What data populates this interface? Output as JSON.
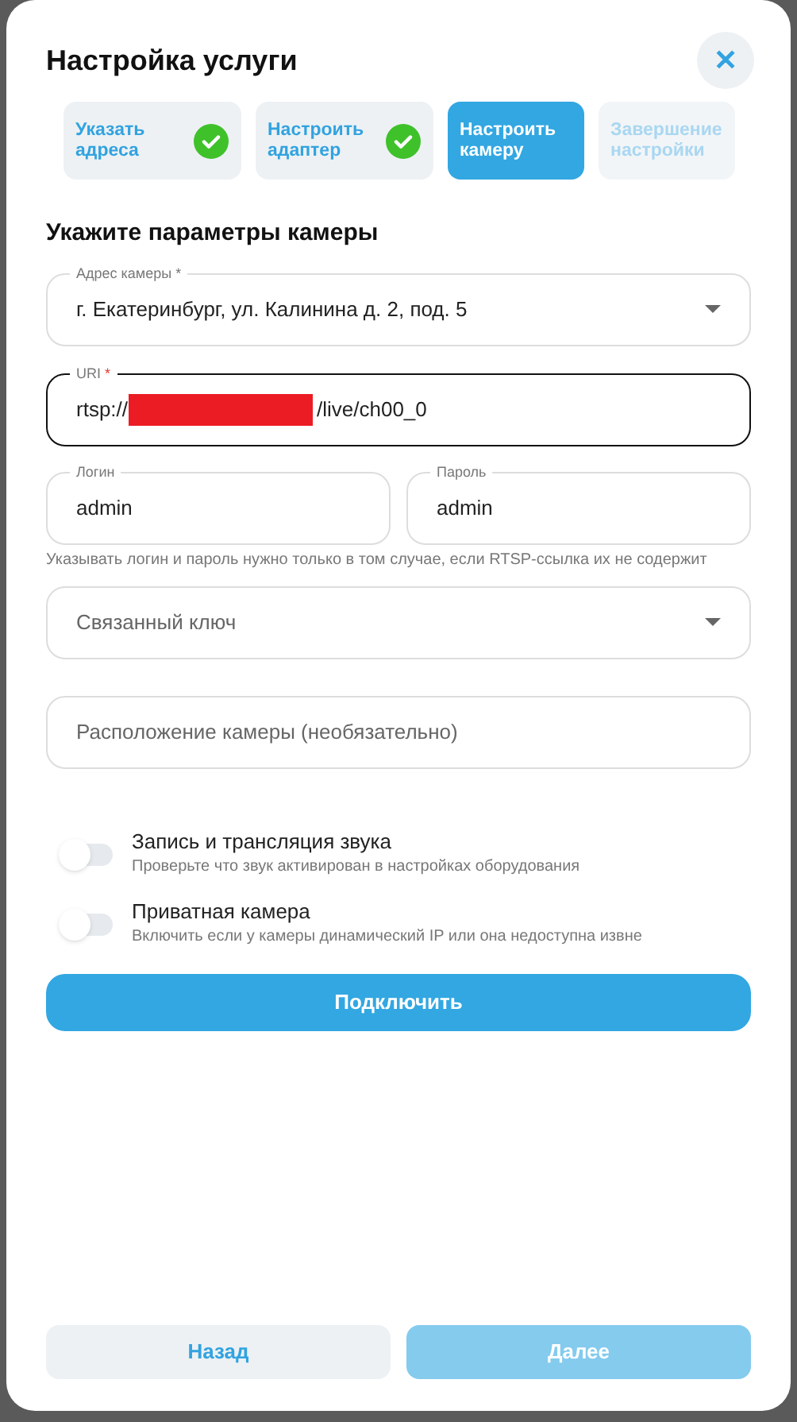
{
  "dialog": {
    "title": "Настройка услуги",
    "close_icon": "✕"
  },
  "steps": [
    {
      "label": "Указать адреса",
      "kind": "done"
    },
    {
      "label": "Настроить адаптер",
      "kind": "done"
    },
    {
      "label": "Настроить камеру",
      "kind": "current"
    },
    {
      "label": "Завершение настройки",
      "kind": "pending"
    }
  ],
  "section_title": "Укажите параметры камеры",
  "address_field": {
    "label": "Адрес камеры *",
    "value": "г. Екатеринбург, ул. Калинина д. 2, под. 5"
  },
  "uri_field": {
    "label": "URI",
    "required_mark": "*",
    "value_start": "rtsp://",
    "redacted": true,
    "value_end": "/live/ch00_0",
    "focused": true
  },
  "login_field": {
    "label": "Логин",
    "value": "admin"
  },
  "password_field": {
    "label": "Пароль",
    "value": "admin"
  },
  "credentials_hint": "Указывать логин и пароль нужно только в том случае, если RTSP-ссылка их не содержит",
  "key_field": {
    "placeholder": "Связанный ключ"
  },
  "location_field": {
    "placeholder": "Расположение камеры (необязательно)"
  },
  "toggles": [
    {
      "title": "Запись и трансляция звука",
      "hint": "Проверьте что звук активирован в настройках оборудования",
      "on": false
    },
    {
      "title": "Приватная камера",
      "hint": "Включить если у камеры динамический IP или она недоступна извне",
      "on": false
    }
  ],
  "connect_button": "Подключить",
  "back_button": {
    "label": "Назад",
    "disabled": false
  },
  "next_button": {
    "label": "Далее",
    "disabled": true
  }
}
